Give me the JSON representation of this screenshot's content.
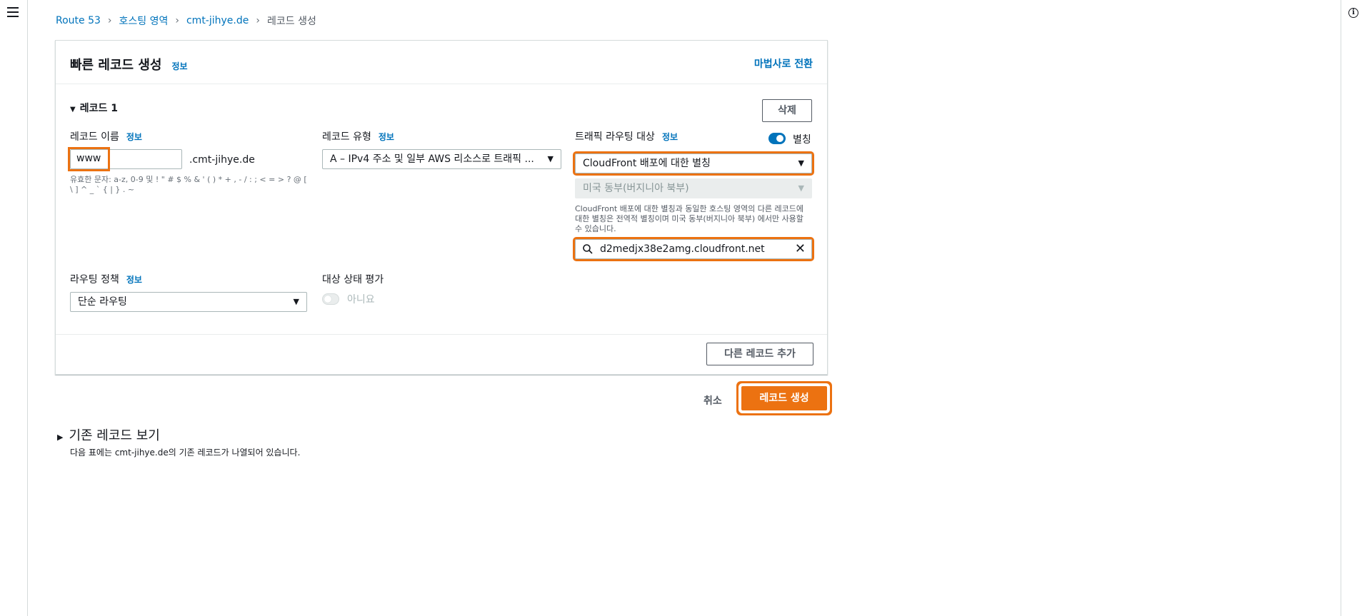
{
  "breadcrumb": {
    "items": [
      "Route 53",
      "호스팅 영역",
      "cmt-jihye.de"
    ],
    "current": "레코드 생성"
  },
  "panel": {
    "title": "빠른 레코드 생성",
    "info": "정보",
    "wizard_link": "마법사로 전환"
  },
  "record": {
    "section_label": "레코드 1",
    "delete_button": "삭제",
    "name": {
      "label": "레코드 이름",
      "info": "정보",
      "value": "www",
      "suffix": ".cmt-jihye.de",
      "hint": "유효한 문자: a-z, 0-9 및 ! \" # $ % & ' ( ) * + , - / : ; < = > ? @ [ \\ ] ^ _ ` { | } . ~"
    },
    "type": {
      "label": "레코드 유형",
      "info": "정보",
      "value": "A – IPv4 주소 및 일부 AWS 리소스로 트래픽 ..."
    },
    "target": {
      "label": "트래픽 라우팅 대상",
      "info": "정보",
      "alias_label": "별칭",
      "alias_on": true,
      "endpoint": "CloudFront 배포에 대한 별칭",
      "region": "미국 동부(버지니아 북부)",
      "note": "CloudFront 배포에 대한 별칭과 동일한 호스팅 영역의 다른 레코드에 대한 별칭은 전역적 별칭이며 미국 동부(버지니아 북부) 에서만 사용할 수 있습니다.",
      "search_value": "d2medjx38e2amg.cloudfront.net"
    },
    "routing_policy": {
      "label": "라우팅 정책",
      "info": "정보",
      "value": "단순 라우팅"
    },
    "health": {
      "label": "대상 상태 평가",
      "value_label": "아니요",
      "on": false
    }
  },
  "add_record_button": "다른 레코드 추가",
  "footer": {
    "cancel": "취소",
    "create": "레코드 생성"
  },
  "existing": {
    "title": "기존 레코드 보기",
    "description": "다음 표에는 cmt-jihye.de의 기존 레코드가 나열되어 있습니다."
  },
  "colors": {
    "accent": "#ec7211",
    "link": "#0073bb"
  }
}
